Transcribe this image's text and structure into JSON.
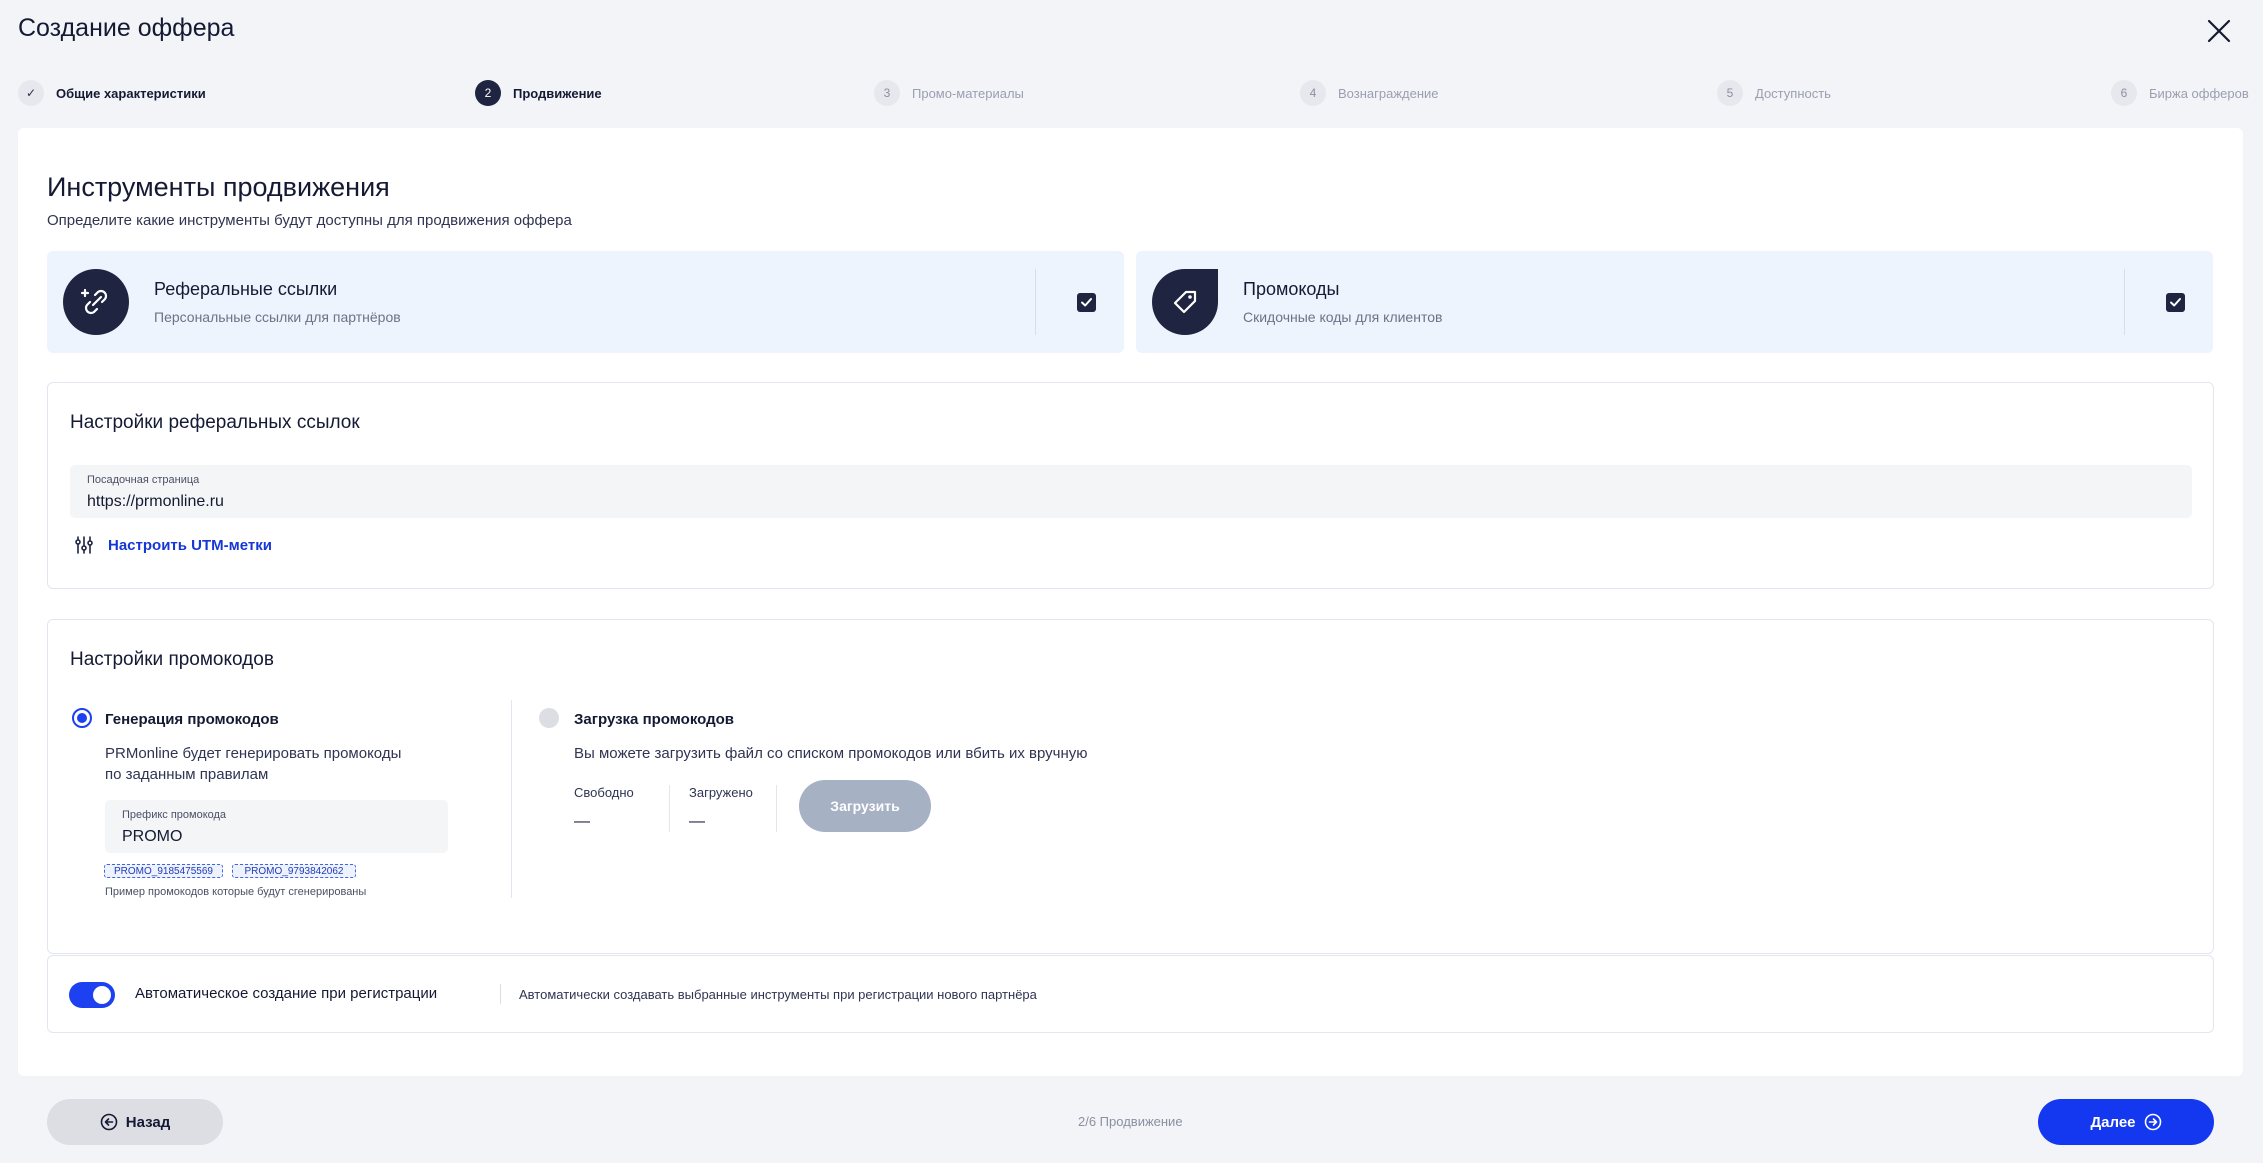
{
  "window": {
    "title": "Создание оффера"
  },
  "stepper": {
    "steps": [
      {
        "num": "✓",
        "label": "Общие характеристики",
        "state": "done"
      },
      {
        "num": "2",
        "label": "Продвижение",
        "state": "active"
      },
      {
        "num": "3",
        "label": "Промо-материалы",
        "state": "pending"
      },
      {
        "num": "4",
        "label": "Вознаграждение",
        "state": "pending"
      },
      {
        "num": "5",
        "label": "Доступность",
        "state": "pending"
      },
      {
        "num": "6",
        "label": "Биржа офферов",
        "state": "pending"
      }
    ]
  },
  "section": {
    "title": "Инструменты продвижения",
    "subtitle": "Определите какие инструменты будут доступны для продвижения оффера"
  },
  "tools": [
    {
      "name": "Реферальные ссылки",
      "desc": "Персональные ссылки для партнёров",
      "checked": true,
      "icon": "link-icon"
    },
    {
      "name": "Промокоды",
      "desc": "Скидочные коды для клиентов",
      "checked": true,
      "icon": "tag-icon"
    }
  ],
  "referral": {
    "title": "Настройки реферальных ссылок",
    "landing_label": "Посадочная страница",
    "landing_value": "https://prmonline.ru",
    "utm_label": "Настроить UTM-метки"
  },
  "promo": {
    "title": "Настройки промокодов",
    "generate": {
      "title": "Генерация промокодов",
      "desc_line1": "PRMonline будет генерировать промокоды",
      "desc_line2": "по заданным правилам",
      "prefix_label": "Префикс промокода",
      "prefix_value": "PROMO",
      "examples": [
        "PROMO_9185475569",
        "PROMO_9793842062"
      ],
      "hint": "Пример промокодов которые будут сгенерированы",
      "selected": true
    },
    "upload": {
      "title": "Загрузка промокодов",
      "desc": "Вы можете загрузить файл со списком промокодов или вбить их вручную",
      "free_label": "Свободно",
      "free_value": "—",
      "loaded_label": "Загружено",
      "loaded_value": "—",
      "button": "Загрузить",
      "selected": false
    }
  },
  "auto": {
    "title": "Автоматическое создание при регистрации",
    "desc": "Автоматически создавать выбранные инструменты при регистрации нового партнёра",
    "enabled": true
  },
  "footer": {
    "back": "Назад",
    "status": "2/6 Продвижение",
    "next": "Далее"
  },
  "colors": {
    "accent": "#1338f0",
    "dark": "#1f2440",
    "tool_bg": "#eef4fd"
  }
}
